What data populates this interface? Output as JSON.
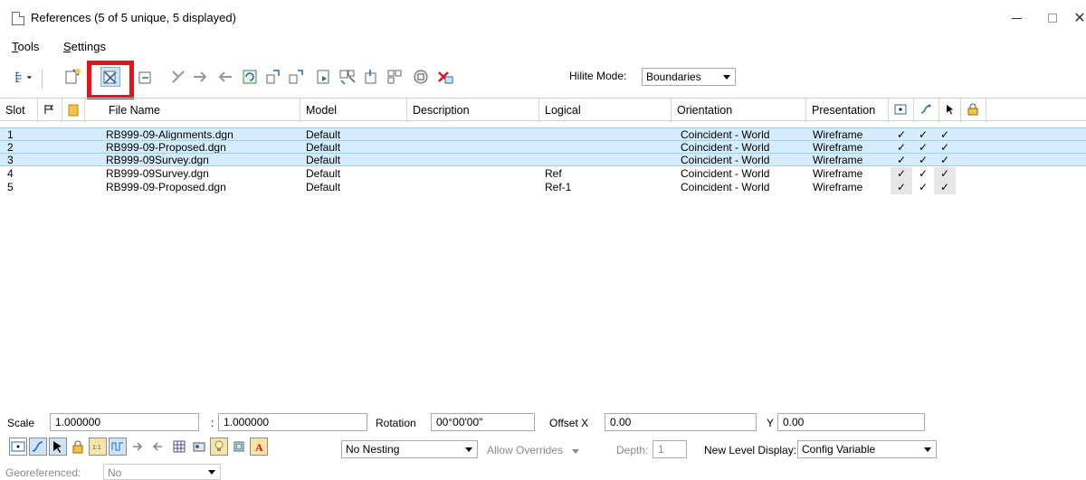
{
  "window": {
    "title": "References (5 of 5 unique, 5 displayed)",
    "minimize_label": "–",
    "maximize_label": "□",
    "close_label": "✕"
  },
  "menu": {
    "tools": "Tools",
    "settings": "Settings"
  },
  "toolbar": {
    "hilite_label": "Hilite Mode:",
    "hilite_value": "Boundaries",
    "icons": [
      "tree-view-icon",
      "attach-reference-icon",
      "detach-reference-icon",
      "reload-icon",
      "exchange-icon",
      "move-icon",
      "copy-icon",
      "scale-icon",
      "rotate-icon",
      "mirror-horizontal-icon",
      "mirror-vertical-icon",
      "clip-boundary-icon",
      "clip-mask-icon",
      "clip-front-icon",
      "clip-back-icon",
      "delete-clip-icon"
    ]
  },
  "table": {
    "columns": [
      "Slot",
      "",
      "",
      "File Name",
      "Model",
      "Description",
      "Logical",
      "Orientation",
      "Presentation"
    ],
    "rows": [
      {
        "slot": "1",
        "file": "RB999-09-Alignments.dgn",
        "model": "Default",
        "description": "",
        "logical": "",
        "orientation": "Coincident - World",
        "presentation": "Wireframe",
        "c1": "✓",
        "c2": "✓",
        "c3": "✓"
      },
      {
        "slot": "2",
        "file": "RB999-09-Proposed.dgn",
        "model": "Default",
        "description": "",
        "logical": "",
        "orientation": "Coincident - World",
        "presentation": "Wireframe",
        "c1": "✓",
        "c2": "✓",
        "c3": "✓"
      },
      {
        "slot": "3",
        "file": "RB999-09Survey.dgn",
        "model": "Default",
        "description": "",
        "logical": "",
        "orientation": "Coincident - World",
        "presentation": "Wireframe",
        "c1": "✓",
        "c2": "✓",
        "c3": "✓"
      },
      {
        "slot": "4",
        "file": "RB999-09Survey.dgn",
        "model": "Default",
        "description": "",
        "logical": "Ref",
        "orientation": "Coincident - World",
        "presentation": "Wireframe",
        "c1": "✓",
        "c2": "✓",
        "c3": "✓"
      },
      {
        "slot": "5",
        "file": "RB999-09-Proposed.dgn",
        "model": "Default",
        "description": "",
        "logical": "Ref-1",
        "orientation": "Coincident - World",
        "presentation": "Wireframe",
        "c1": "✓",
        "c2": "✓",
        "c3": "✓"
      }
    ]
  },
  "bottom": {
    "scale_label": "Scale",
    "scale_value1": "1.000000",
    "scale_sep": ":",
    "scale_value2": "1.000000",
    "rotation_label": "Rotation",
    "rotation_value": "00°00'00\"",
    "offset_x_label": "Offset X",
    "offset_x_value": "0.00",
    "offset_y_label": "Y",
    "offset_y_value": "0.00",
    "nesting_value": "No Nesting",
    "overrides_value": "Allow Overrides",
    "depth_label": "Depth:",
    "depth_value": "1",
    "new_level_label": "New Level Display:",
    "new_level_value": "Config Variable",
    "georef_label": "Georeferenced:",
    "georef_value": "No"
  },
  "colors": {
    "highlight_row": "#d4ecfb",
    "red_callout": "#e8121a"
  }
}
